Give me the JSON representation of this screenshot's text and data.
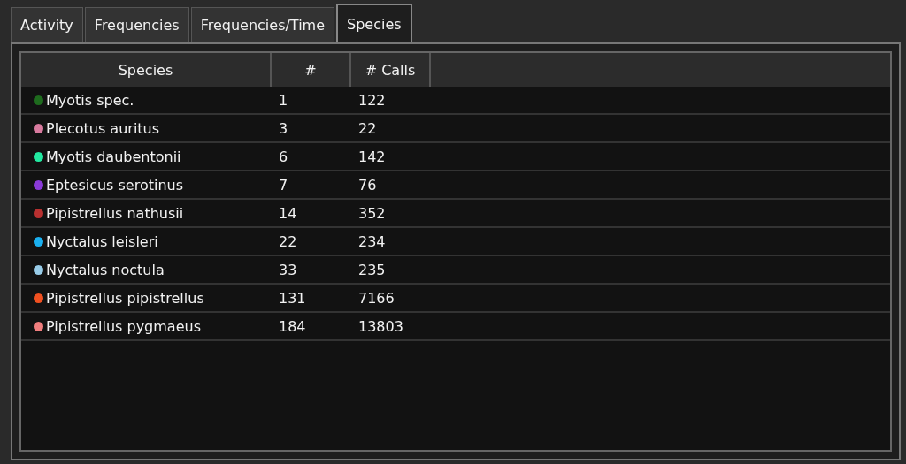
{
  "tabs": [
    {
      "label": "Activity",
      "selected": false
    },
    {
      "label": "Frequencies",
      "selected": false
    },
    {
      "label": "Frequencies/Time",
      "selected": false
    },
    {
      "label": "Species",
      "selected": true
    }
  ],
  "table": {
    "columns": [
      "Species",
      "#",
      "# Calls"
    ],
    "rows": [
      {
        "species": "Myotis spec.",
        "color": "#1e6b1e",
        "count": "1",
        "calls": "122"
      },
      {
        "species": "Plecotus auritus",
        "color": "#d87a9e",
        "count": "3",
        "calls": "22"
      },
      {
        "species": "Myotis daubentonii",
        "color": "#22e8a0",
        "count": "6",
        "calls": "142"
      },
      {
        "species": "Eptesicus serotinus",
        "color": "#8a3ad8",
        "count": "7",
        "calls": "76"
      },
      {
        "species": "Pipistrellus nathusii",
        "color": "#b83030",
        "count": "14",
        "calls": "352"
      },
      {
        "species": "Nyctalus leisleri",
        "color": "#1ab0f0",
        "count": "22",
        "calls": "234"
      },
      {
        "species": "Nyctalus noctula",
        "color": "#98cce8",
        "count": "33",
        "calls": "235"
      },
      {
        "species": "Pipistrellus pipistrellus",
        "color": "#f05020",
        "count": "131",
        "calls": "7166"
      },
      {
        "species": "Pipistrellus pygmaeus",
        "color": "#f07e7e",
        "count": "184",
        "calls": "13803"
      }
    ]
  }
}
